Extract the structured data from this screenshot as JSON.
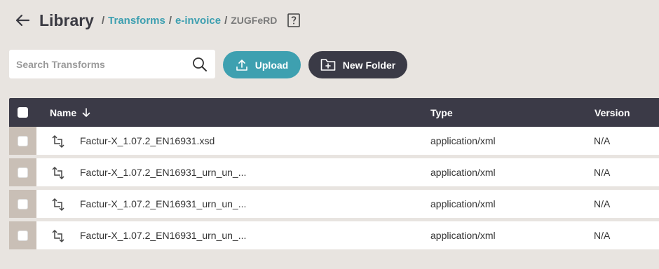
{
  "header": {
    "title": "Library",
    "separator": "/",
    "breadcrumbs": [
      {
        "label": "Transforms"
      },
      {
        "label": "e-invoice"
      }
    ],
    "current": "ZUGFeRD"
  },
  "toolbar": {
    "search_placeholder": "Search Transforms",
    "upload_label": "Upload",
    "new_folder_label": "New Folder"
  },
  "table": {
    "columns": {
      "name": "Name",
      "type": "Type",
      "version": "Version"
    },
    "rows": [
      {
        "name": "Factur-X_1.07.2_EN16931.xsd",
        "type": "application/xml",
        "version": "N/A"
      },
      {
        "name": "Factur-X_1.07.2_EN16931_urn_un_...",
        "type": "application/xml",
        "version": "N/A"
      },
      {
        "name": "Factur-X_1.07.2_EN16931_urn_un_...",
        "type": "application/xml",
        "version": "N/A"
      },
      {
        "name": "Factur-X_1.07.2_EN16931_urn_un_...",
        "type": "application/xml",
        "version": "N/A"
      }
    ]
  },
  "colors": {
    "background": "#e8e4e0",
    "accent": "#3ea0b0",
    "dark": "#3b3a47",
    "row_check_bg": "#c9bfb6"
  },
  "icons": {
    "back": "arrow-left-icon",
    "help": "help-icon",
    "search": "search-icon",
    "upload": "upload-icon",
    "new_folder": "folder-plus-icon",
    "sort": "arrow-down-icon",
    "transform": "transform-icon"
  }
}
